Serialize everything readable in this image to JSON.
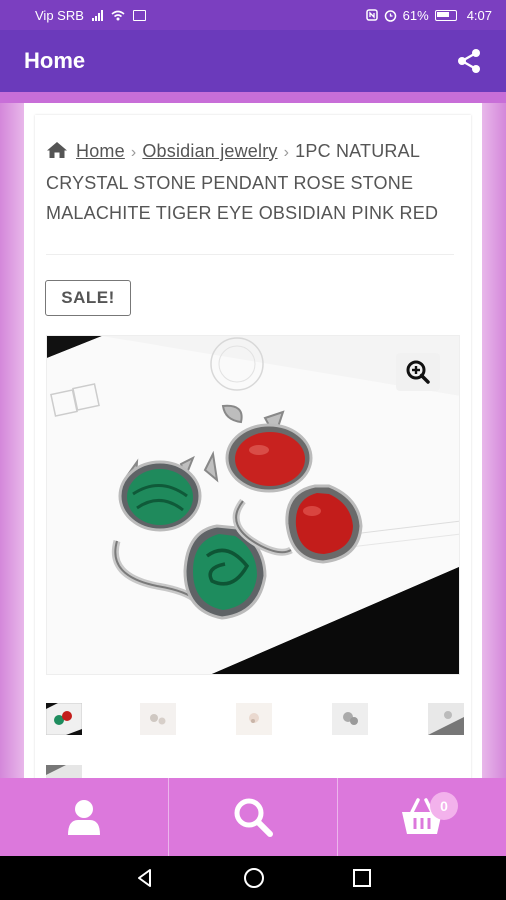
{
  "status_bar": {
    "carrier": "Vip SRB",
    "battery": "61%",
    "time": "4:07",
    "icons": [
      "signal-icon",
      "wifi-icon",
      "nfc-icon",
      "alarm-icon",
      "battery-icon"
    ]
  },
  "app_bar": {
    "title": "Home",
    "share_icon": "share-icon"
  },
  "breadcrumb": {
    "home_label": "Home",
    "category_label": "Obsidian jewelry",
    "separator": "›",
    "current": "1PC NATURAL CRYSTAL STONE PENDANT ROSE STONE MALACHITE TIGER EYE OBSIDIAN PINK RED"
  },
  "product": {
    "sale_badge": "SALE!",
    "zoom_icon": "zoom-in-icon",
    "thumbnail_count": 6
  },
  "bottom_nav": {
    "account_icon": "user-icon",
    "search_icon": "search-icon",
    "cart_icon": "cart-icon",
    "cart_count": "0"
  },
  "system_nav": [
    "back-icon",
    "home-icon",
    "recents-icon"
  ],
  "colors": {
    "status_bar": "#7b3fc0",
    "app_bar": "#6b3abb",
    "accent": "#c86ed8",
    "bottom_nav": "#dc78dc",
    "side_panel": "#e7b4e6"
  }
}
